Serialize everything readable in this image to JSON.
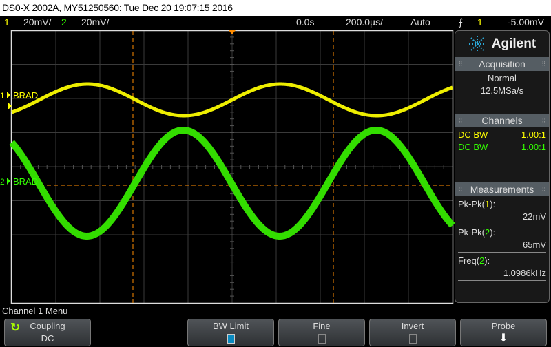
{
  "title_bar": "DS0-X 2002A, MY51250560: Tue Dec 20 19:07:15 2016",
  "status": {
    "ch1_label": "1",
    "ch1_scale": "20mV/",
    "ch2_label": "2",
    "ch2_scale": "20mV/",
    "time_delay": "0.0s",
    "time_scale": "200.0µs/",
    "trigger_mode": "Auto",
    "trigger_icon": "rising-edge-icon",
    "trigger_source": "1",
    "trigger_level": "-5.00mV"
  },
  "traces": {
    "ch1_marker": "1",
    "ch1_label": "BRAD",
    "ch2_marker": "2",
    "ch2_label": "BRAD"
  },
  "colors": {
    "ch1": "#ffff00",
    "ch2": "#33ff00",
    "cursor": "#ff8c00",
    "accent": "#0a8ac0"
  },
  "panel": {
    "brand": "Agilent",
    "acquisition": {
      "title": "Acquisition",
      "mode": "Normal",
      "rate": "12.5MSa/s"
    },
    "channels": {
      "title": "Channels",
      "rows": [
        {
          "label": "DC BW",
          "probe": "1.00:1"
        },
        {
          "label": "DC BW",
          "probe": "1.00:1"
        }
      ]
    },
    "measurements": {
      "title": "Measurements",
      "items": [
        {
          "name": "Pk-Pk(",
          "ch": "1",
          "close": "):",
          "value": "22mV"
        },
        {
          "name": "Pk-Pk(",
          "ch": "2",
          "close": "):",
          "value": "65mV"
        },
        {
          "name": "Freq(",
          "ch": "2",
          "close": "):",
          "value": "1.0986kHz"
        }
      ]
    }
  },
  "menu": {
    "title": "Channel 1 Menu",
    "coupling": {
      "label": "Coupling",
      "value": "DC"
    },
    "bw_limit": {
      "label": "BW Limit",
      "checked": true
    },
    "fine": {
      "label": "Fine",
      "checked": false
    },
    "invert": {
      "label": "Invert",
      "checked": false
    },
    "probe": {
      "label": "Probe"
    }
  }
}
